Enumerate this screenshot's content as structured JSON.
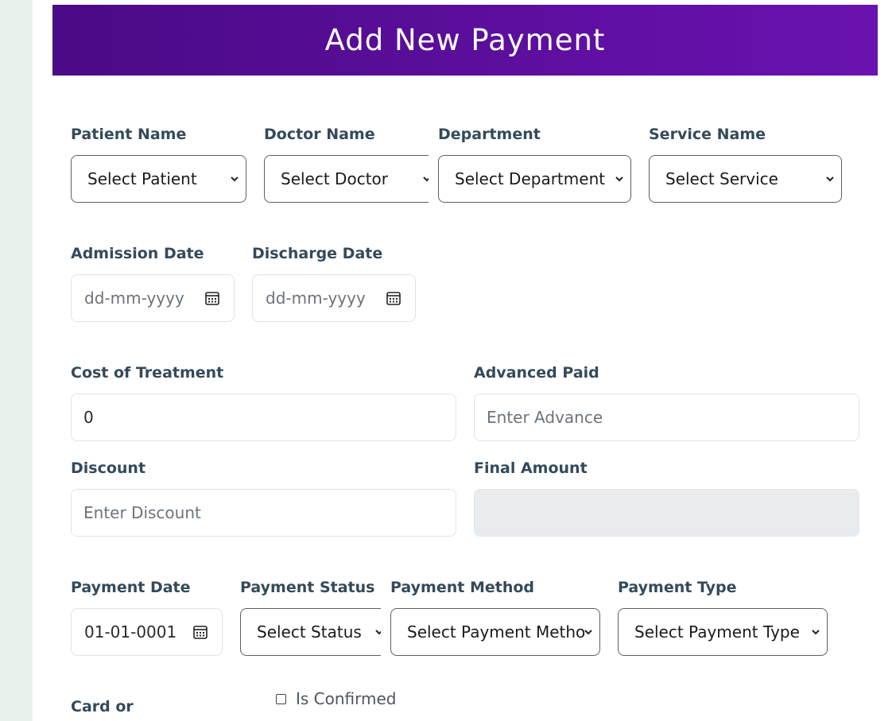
{
  "page": {
    "title": "Add New Payment"
  },
  "fields": {
    "patient": {
      "label": "Patient Name",
      "value": "Select Patient"
    },
    "doctor": {
      "label": "Doctor Name",
      "value": "Select Doctor"
    },
    "department": {
      "label": "Department",
      "value": "Select Department"
    },
    "service": {
      "label": "Service Name",
      "value": "Select Service"
    },
    "admission_date": {
      "label": "Admission Date",
      "placeholder": "dd-mm-yyyy"
    },
    "discharge_date": {
      "label": "Discharge Date",
      "placeholder": "dd-mm-yyyy"
    },
    "cost_of_treatment": {
      "label": "Cost of Treatment",
      "value": "0"
    },
    "advanced_paid": {
      "label": "Advanced Paid",
      "placeholder": "Enter Advance"
    },
    "discount": {
      "label": "Discount",
      "placeholder": "Enter Discount"
    },
    "final_amount": {
      "label": "Final Amount",
      "value": ""
    },
    "payment_date": {
      "label": "Payment Date",
      "value": "01-01-0001"
    },
    "payment_status": {
      "label": "Payment Status",
      "value": "Select Status"
    },
    "payment_method": {
      "label": "Payment Method",
      "value": "Select Payment Metho"
    },
    "payment_type": {
      "label": "Payment Type",
      "value": "Select Payment Type"
    },
    "card_or": {
      "label": "Card or"
    },
    "is_confirmed": {
      "label": "Is Confirmed",
      "checked": false
    }
  },
  "icons": {
    "select_arrow": "chevron-down-icon",
    "date_picker": "calendar-icon"
  },
  "colors": {
    "header_start": "#4b0a86",
    "header_end": "#6a12b0",
    "label": "#344a5a",
    "sidebar": "#e6f2ec"
  }
}
